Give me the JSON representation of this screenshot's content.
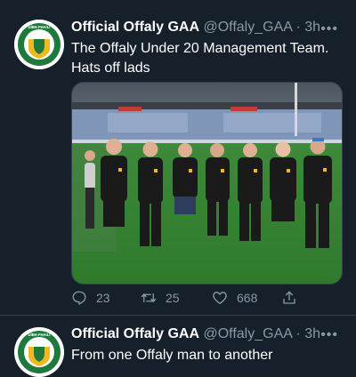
{
  "tweets": [
    {
      "author_name": "Official Offaly GAA",
      "handle": "@Offaly_GAA",
      "separator": " · ",
      "time": "3h",
      "more": "•••",
      "text": "The Offaly Under 20 Management Team. Hats off lads",
      "replies": "23",
      "retweets": "25",
      "likes": "668",
      "avatar_text": "UÍBH FHAILÍ"
    },
    {
      "author_name": "Official Offaly GAA",
      "handle": "@Offaly_GAA",
      "separator": " · ",
      "time": "3h",
      "more": "•••",
      "text": "From one Offaly man to another",
      "avatar_text": "UÍBH FHAILÍ"
    }
  ],
  "colors": {
    "background": "#15202b",
    "secondary_text": "#8899a6",
    "divider": "#38444d",
    "offaly_green": "#1e7a3c",
    "offaly_gold": "#f2b820"
  }
}
